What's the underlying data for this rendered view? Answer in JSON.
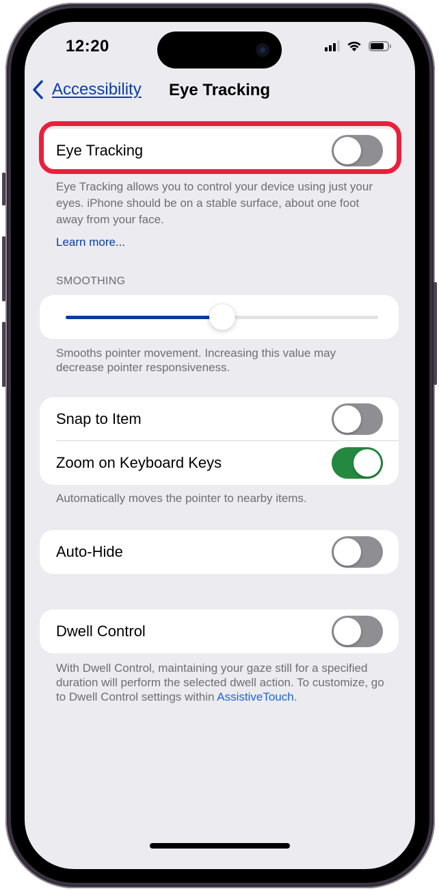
{
  "status_bar": {
    "time": "12:20",
    "signal_bars": 3,
    "signal_bars_total": 4,
    "battery_level_percent": 78
  },
  "nav": {
    "back_label": "Accessibility",
    "title": "Eye Tracking"
  },
  "eye_tracking": {
    "label": "Eye Tracking",
    "enabled": false,
    "description": "Eye Tracking allows you to control your device using just your eyes. iPhone should be on a stable surface, about one foot away from your face.",
    "learn_more": "Learn more..."
  },
  "smoothing": {
    "header": "SMOOTHING",
    "value_fraction": 0.5,
    "description": "Smooths pointer movement. Increasing this value may decrease pointer responsiveness."
  },
  "pointer_group": {
    "items": [
      {
        "label": "Snap to Item",
        "enabled": false
      },
      {
        "label": "Zoom on Keyboard Keys",
        "enabled": true
      }
    ],
    "footer": "Automatically moves the pointer to nearby items."
  },
  "auto_hide": {
    "label": "Auto-Hide",
    "enabled": false
  },
  "dwell_control": {
    "label": "Dwell Control",
    "enabled": false,
    "footer_text": "With Dwell Control, maintaining your gaze still for a specified duration will perform the selected dwell action. To customize, go to Dwell Control settings within ",
    "footer_link": "AssistiveTouch",
    "footer_suffix": "."
  },
  "colors": {
    "accent": "#0a3ea8",
    "toggle_on": "#258840",
    "toggle_off": "#8e8e93",
    "highlight": "#e8203d",
    "background": "#ebebf0"
  }
}
